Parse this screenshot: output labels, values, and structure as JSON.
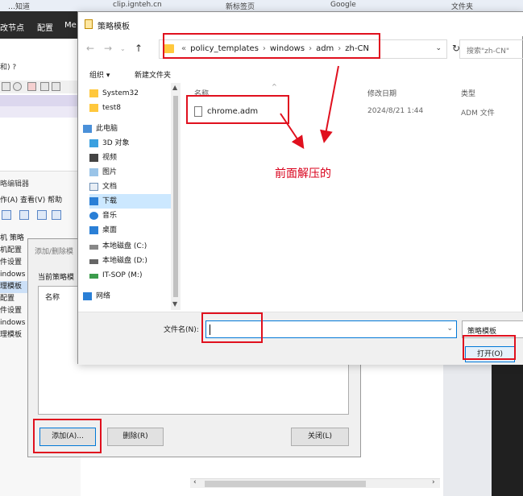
{
  "browser": {
    "tabs": [
      "…知道",
      "clip.ignteh.cn",
      "新标签页",
      "Google",
      "文件夹"
    ]
  },
  "mmc": {
    "title_parts": [
      "改节点",
      "配置",
      "Me"
    ],
    "menu": "和) ?"
  },
  "gpe": {
    "title": "略编辑器",
    "menu": "作(A)   查看(V)   帮助",
    "tree": [
      "机 策略",
      "机配置",
      "件设置",
      "indows",
      "理模板",
      "配置",
      "件设置",
      "indows",
      "理模板"
    ]
  },
  "add_remove": {
    "title": "添加/删除模",
    "current_label": "当前策略模",
    "col_name": "名称",
    "add_button": "添加(A)...",
    "delete_button": "删除(R)",
    "close_button": "关闭(L)"
  },
  "file_dialog": {
    "title": "策略模板",
    "breadcrumb": [
      "policy_templates",
      "windows",
      "adm",
      "zh-CN"
    ],
    "search_placeholder": "搜索\"zh-CN\"",
    "organize": "组织 ▾",
    "new_folder": "新建文件夹",
    "nav_items": [
      {
        "label": "System32",
        "icon": "folder-icon"
      },
      {
        "label": "test8",
        "icon": "folder-icon"
      },
      {
        "label": "此电脑",
        "icon": "computer-icon"
      },
      {
        "label": "3D 对象",
        "icon": "cube-icon"
      },
      {
        "label": "视频",
        "icon": "video-icon"
      },
      {
        "label": "图片",
        "icon": "picture-icon"
      },
      {
        "label": "文档",
        "icon": "document-icon"
      },
      {
        "label": "下载",
        "icon": "download-icon"
      },
      {
        "label": "音乐",
        "icon": "music-icon"
      },
      {
        "label": "桌面",
        "icon": "desktop-icon"
      },
      {
        "label": "本地磁盘 (C:)",
        "icon": "drive-icon"
      },
      {
        "label": "本地磁盘 (D:)",
        "icon": "drive-icon"
      },
      {
        "label": "IT-SOP (M:)",
        "icon": "network-drive-icon"
      },
      {
        "label": "网络",
        "icon": "network-icon"
      }
    ],
    "selected_nav": "下载",
    "columns": {
      "name": "名称",
      "modified": "修改日期",
      "type": "类型"
    },
    "files": [
      {
        "name": "chrome.adm",
        "modified": "2024/8/21 1:44",
        "type": "ADM 文件"
      }
    ],
    "annotation": "前面解压的",
    "filename_label": "文件名(N):",
    "filename_value": "",
    "filetype": "策略模板",
    "open_button": "打开(O)"
  },
  "colors": {
    "highlight": "#e0101e",
    "accent": "#0078d7",
    "selected": "#cce8ff"
  }
}
